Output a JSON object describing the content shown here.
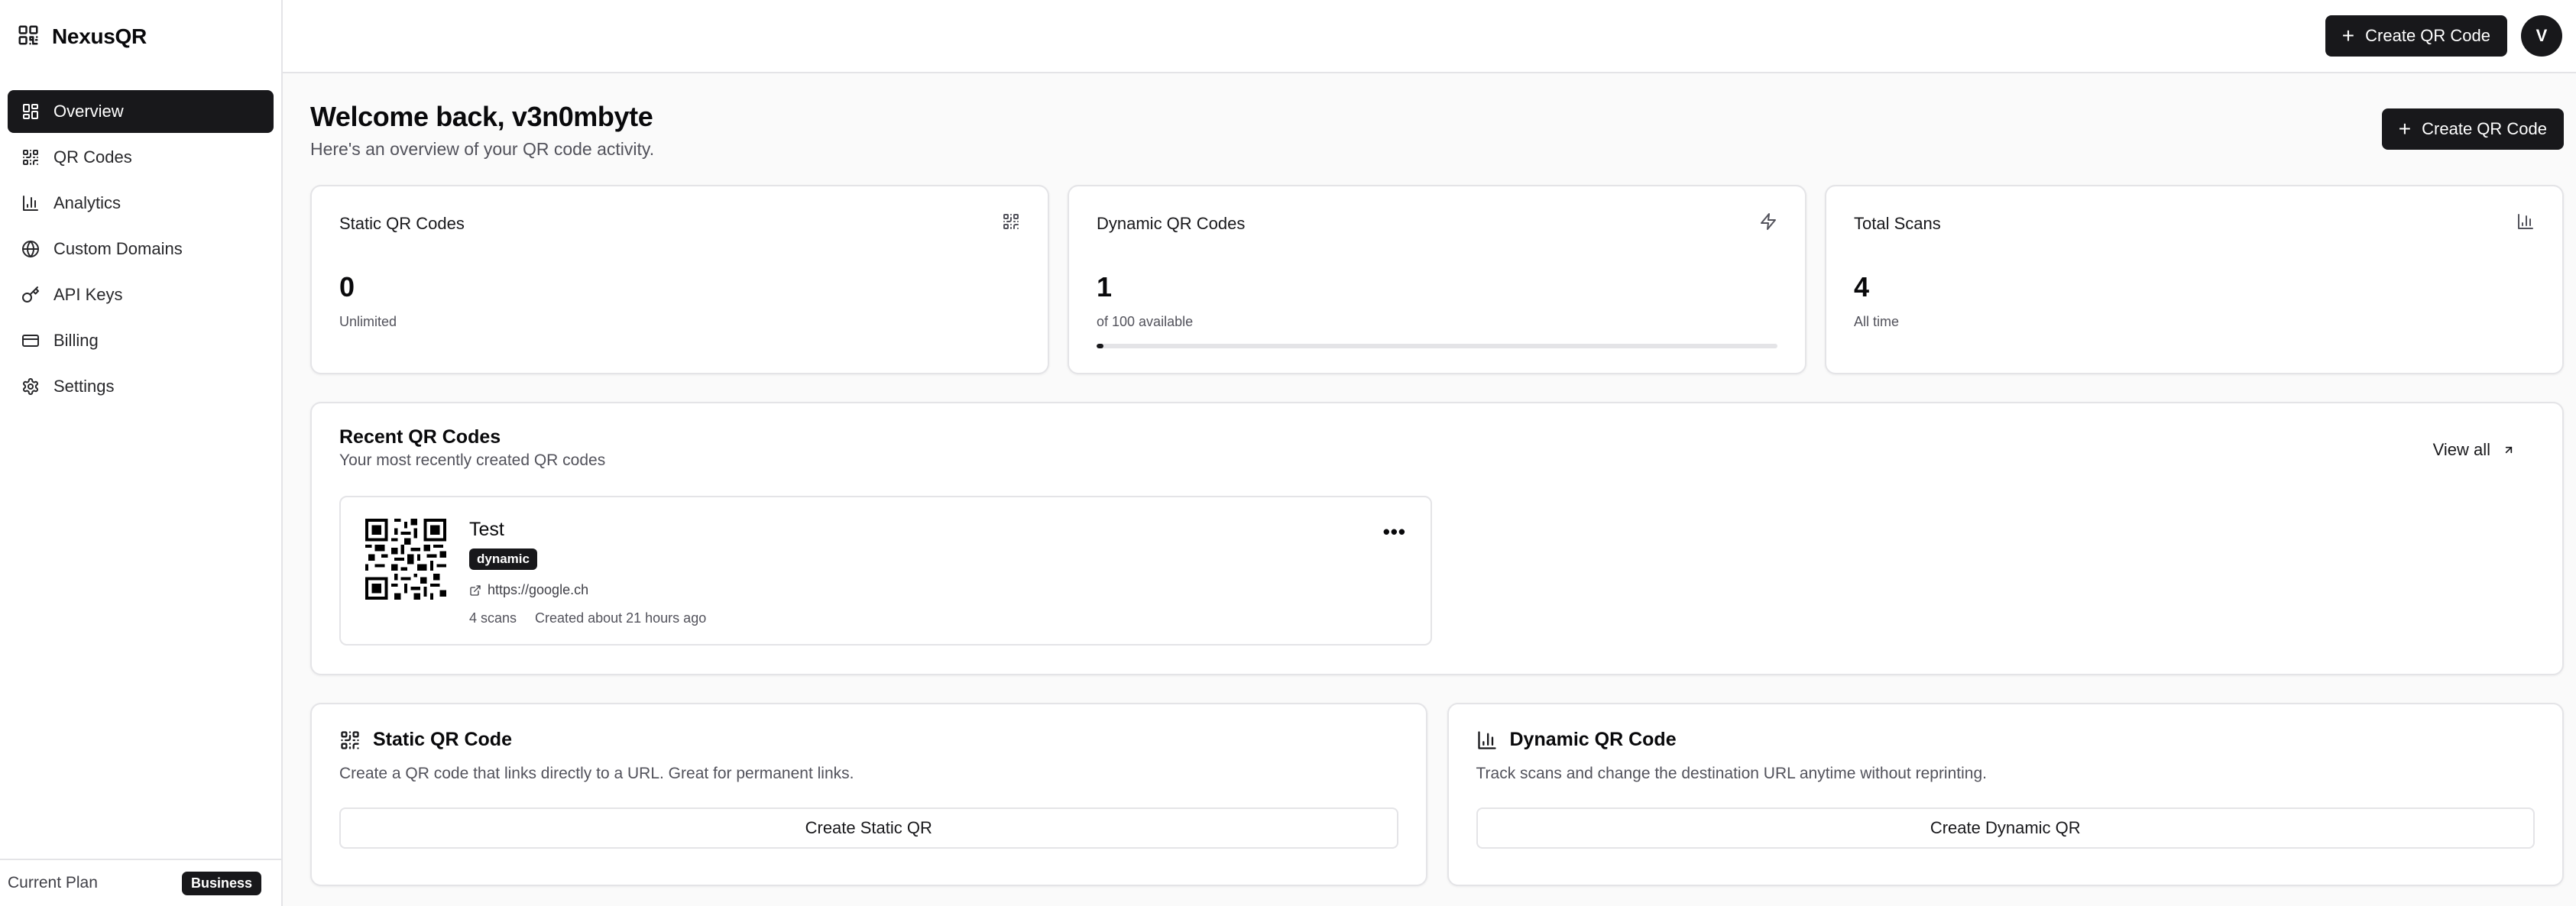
{
  "brand": {
    "name": "NexusQR"
  },
  "sidebar": {
    "items": [
      {
        "label": "Overview",
        "icon": "grid-icon",
        "active": true
      },
      {
        "label": "QR Codes",
        "icon": "qr-icon",
        "active": false
      },
      {
        "label": "Analytics",
        "icon": "bar-chart-icon",
        "active": false
      },
      {
        "label": "Custom Domains",
        "icon": "globe-icon",
        "active": false
      },
      {
        "label": "API Keys",
        "icon": "key-icon",
        "active": false
      },
      {
        "label": "Billing",
        "icon": "credit-card-icon",
        "active": false
      },
      {
        "label": "Settings",
        "icon": "gear-icon",
        "active": false
      }
    ],
    "footer": {
      "label": "Current Plan",
      "badge": "Business"
    }
  },
  "topbar": {
    "create_label": "Create QR Code",
    "avatar_initial": "V"
  },
  "welcome": {
    "title": "Welcome back, v3n0mbyte",
    "subtitle": "Here's an overview of your QR code activity.",
    "create_label": "Create QR Code"
  },
  "stats": [
    {
      "title": "Static QR Codes",
      "value": "0",
      "desc": "Unlimited",
      "icon": "qr-icon"
    },
    {
      "title": "Dynamic QR Codes",
      "value": "1",
      "desc": "of 100 available",
      "icon": "zap-icon",
      "progress": 0.01
    },
    {
      "title": "Total Scans",
      "value": "4",
      "desc": "All time",
      "icon": "bar-chart-icon"
    }
  ],
  "recent": {
    "title": "Recent QR Codes",
    "subtitle": "Your most recently created QR codes",
    "view_all": "View all",
    "items": [
      {
        "name": "Test",
        "type": "dynamic",
        "url": "https://google.ch",
        "scans": "4 scans",
        "created": "Created about 21 hours ago"
      }
    ]
  },
  "create_cards": [
    {
      "title": "Static QR Code",
      "desc": "Create a QR code that links directly to a URL. Great for permanent links.",
      "button": "Create Static QR",
      "icon": "qr-icon"
    },
    {
      "title": "Dynamic QR Code",
      "desc": "Track scans and change the destination URL anytime without reprinting.",
      "button": "Create Dynamic QR",
      "icon": "bar-chart-icon"
    }
  ],
  "colors": {
    "primary": "#18181b",
    "border": "#e4e4e7",
    "muted": "#52525b",
    "background": "#fafafa"
  }
}
